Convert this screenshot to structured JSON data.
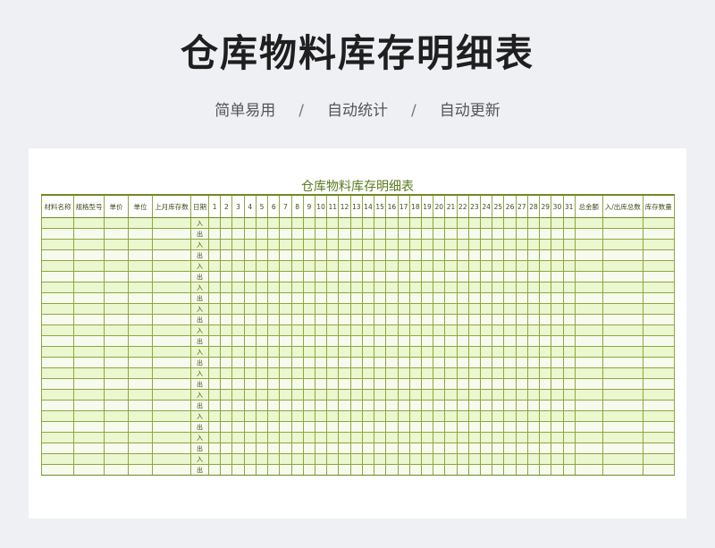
{
  "header": {
    "title": "仓库物料库存明细表",
    "features": [
      "简单易用",
      "自动统计",
      "自动更新"
    ],
    "separator": "/"
  },
  "sheet": {
    "title": "仓库物料库存明细表",
    "columns_left": [
      "材料名称",
      "规格型号",
      "单价",
      "单位",
      "上月库存数",
      "日期"
    ],
    "days": [
      "1",
      "2",
      "3",
      "4",
      "5",
      "6",
      "7",
      "8",
      "9",
      "10",
      "11",
      "12",
      "13",
      "14",
      "15",
      "16",
      "17",
      "18",
      "19",
      "20",
      "21",
      "22",
      "23",
      "24",
      "25",
      "26",
      "27",
      "28",
      "29",
      "30",
      "31"
    ],
    "columns_right": [
      "总金额",
      "入/出库总数",
      "库存数量"
    ],
    "row_labels": [
      "入",
      "出",
      "入",
      "出",
      "入",
      "出",
      "入",
      "出",
      "入",
      "出",
      "入",
      "出",
      "入",
      "出",
      "入",
      "出",
      "入",
      "出",
      "入",
      "出",
      "入",
      "出",
      "入",
      "出"
    ]
  },
  "colors": {
    "background": "#eff0f4",
    "accent_green": "#5a7a1e",
    "grid_line": "#8fa63f",
    "row_in_fill": "#eaf7cf",
    "row_out_fill": "#f6fbee"
  }
}
